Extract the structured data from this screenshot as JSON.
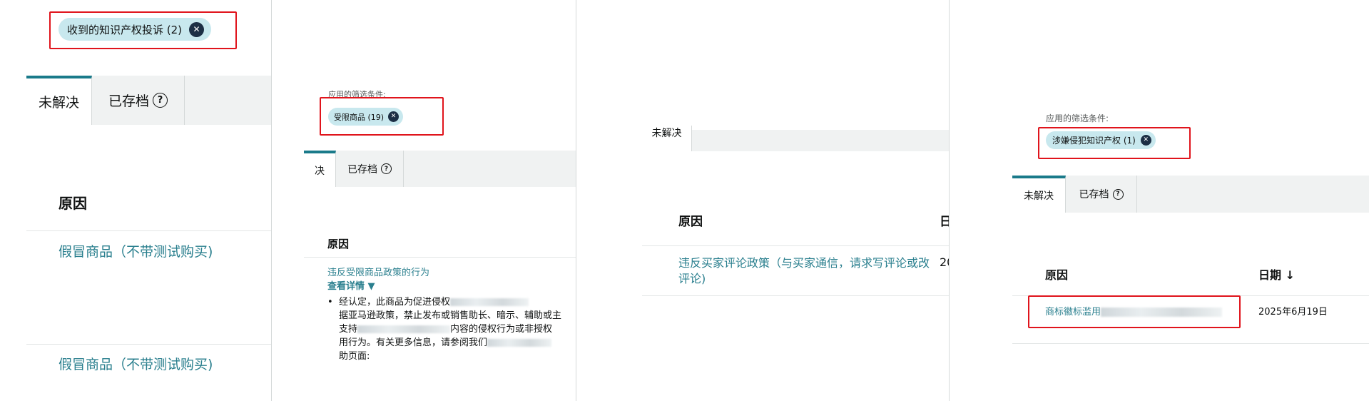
{
  "panel1": {
    "filter_chip": "收到的知识产权投诉 (2)",
    "tabs": {
      "unresolved": "未解决",
      "archived": "已存档"
    },
    "table_header_reason": "原因",
    "rows": [
      "假冒商品（不带测试购买)",
      "假冒商品（不带测试购买)"
    ]
  },
  "panel2": {
    "filter_label": "应用的筛选条件:",
    "filter_chip": "受限商品 (19)",
    "tabs": {
      "unresolved": "决",
      "archived": "已存档"
    },
    "table_header_reason": "原因",
    "reason_link": "违反受限商品政策的行为",
    "details_link": "查看详情 ▼",
    "detail_lines": [
      "经认定，此商品为促进侵权",
      "据亚马逊政策，禁止发布或销售助长、暗示、辅助或主",
      "支持",
      "内容的侵权行为或非授权",
      "用行为。有关更多信息，请参阅我们",
      "助页面:"
    ]
  },
  "panel3": {
    "tab_unresolved": "未解决",
    "table_header_reason": "原因",
    "table_header_date": "日",
    "row_reason": "违反买家评论政策（与买家通信，请求写评论或改评论)",
    "row_date": "20"
  },
  "panel4": {
    "filter_label": "应用的筛选条件:",
    "filter_chip": "涉嫌侵犯知识产权 (1)",
    "tabs": {
      "unresolved": "未解决",
      "archived": "已存档"
    },
    "table_header_reason": "原因",
    "table_header_date": "日期 ↓",
    "row_reason": "商标徽标滥用",
    "row_date": "2025年6月19日"
  },
  "icons": {
    "chip_close": "close-circle-icon",
    "help": "question-circle-icon"
  },
  "colors": {
    "link": "#2a7f8e",
    "chip_bg": "#c8e8ee",
    "highlight": "#e0141c",
    "active_tab": "#1a7a8a"
  }
}
